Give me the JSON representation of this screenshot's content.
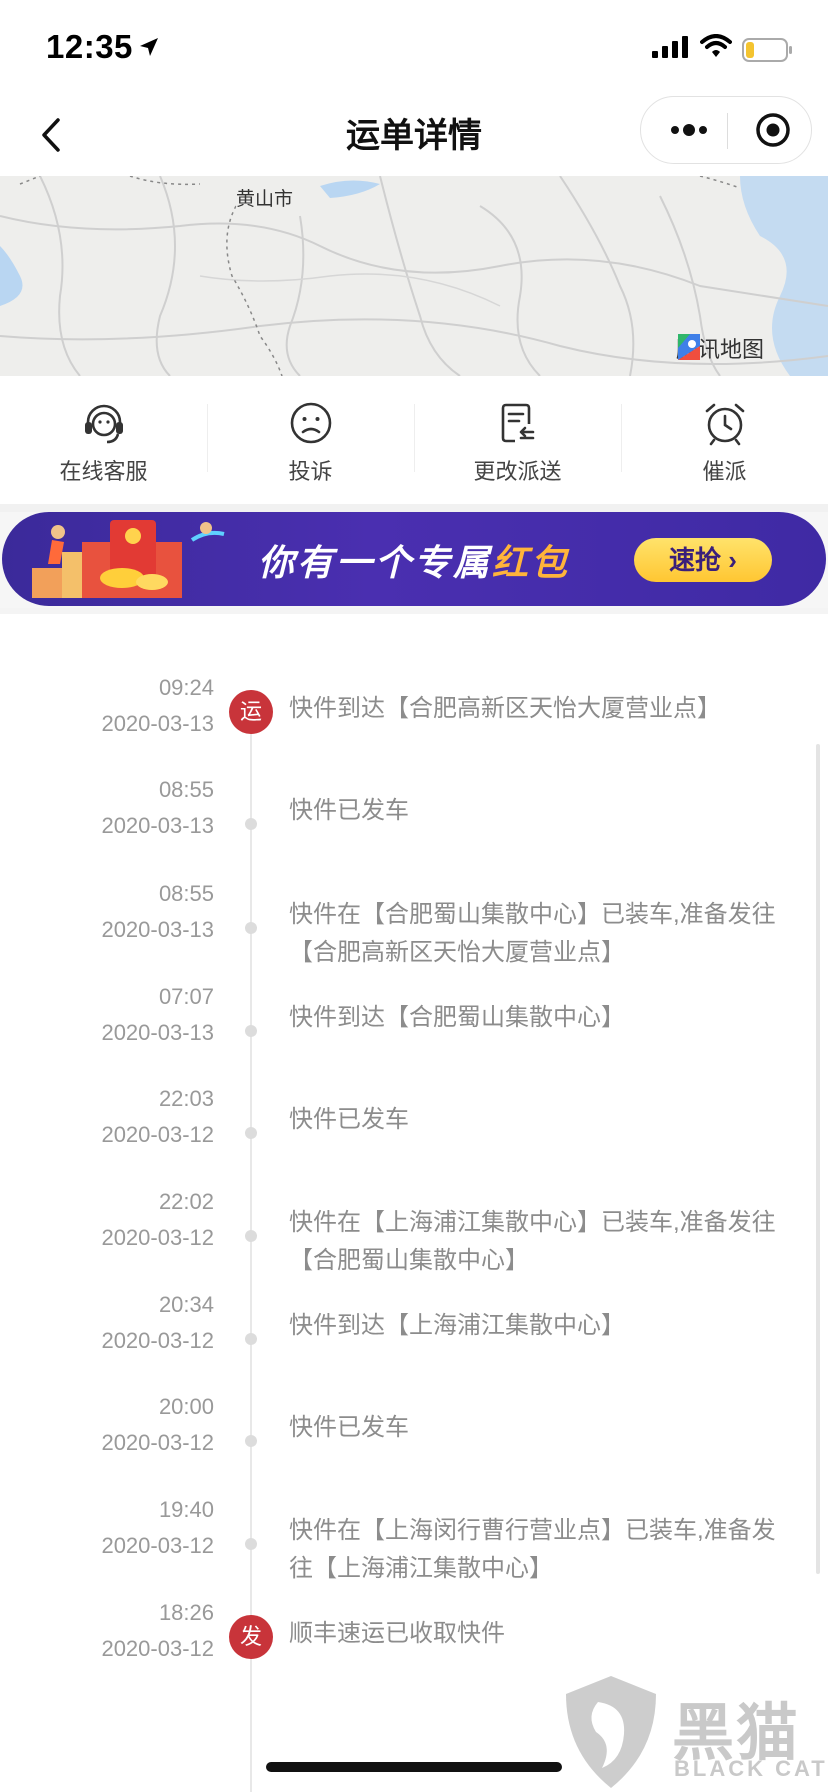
{
  "status_bar": {
    "time": "12:35"
  },
  "nav": {
    "title": "运单详情"
  },
  "map": {
    "city_label": "黄山市",
    "provider": "腾讯地图"
  },
  "actions": [
    {
      "label": "在线客服",
      "icon": "headset-icon"
    },
    {
      "label": "投诉",
      "icon": "sad-face-icon"
    },
    {
      "label": "更改派送",
      "icon": "edit-document-icon"
    },
    {
      "label": "催派",
      "icon": "alarm-clock-icon"
    }
  ],
  "banner": {
    "text_prefix": "你有一个专属",
    "text_highlight": "红包",
    "button_label": "速抢"
  },
  "timeline": [
    {
      "time": "09:24",
      "date": "2020-03-13",
      "text": "快件到达【合肥高新区天怡大厦营业点】",
      "badge": "运"
    },
    {
      "time": "08:55",
      "date": "2020-03-13",
      "text": "快件已发车",
      "badge": ""
    },
    {
      "time": "08:55",
      "date": "2020-03-13",
      "text": "快件在【合肥蜀山集散中心】已装车,准备发往【合肥高新区天怡大厦营业点】",
      "badge": ""
    },
    {
      "time": "07:07",
      "date": "2020-03-13",
      "text": "快件到达【合肥蜀山集散中心】",
      "badge": ""
    },
    {
      "time": "22:03",
      "date": "2020-03-12",
      "text": "快件已发车",
      "badge": ""
    },
    {
      "time": "22:02",
      "date": "2020-03-12",
      "text": "快件在【上海浦江集散中心】已装车,准备发往【合肥蜀山集散中心】",
      "badge": ""
    },
    {
      "time": "20:34",
      "date": "2020-03-12",
      "text": "快件到达【上海浦江集散中心】",
      "badge": ""
    },
    {
      "time": "20:00",
      "date": "2020-03-12",
      "text": "快件已发车",
      "badge": ""
    },
    {
      "time": "19:40",
      "date": "2020-03-12",
      "text": "快件在【上海闵行曹行营业点】已装车,准备发往【上海浦江集散中心】",
      "badge": ""
    },
    {
      "time": "18:26",
      "date": "2020-03-12",
      "text": "顺丰速运已收取快件",
      "badge": "发"
    }
  ],
  "watermark": {
    "text": "黑猫",
    "sub": "BLACK CAT"
  },
  "colors": {
    "badge_red": "#c8343a",
    "banner_purple": "#4a2fb0",
    "banner_button": "#ffc632"
  }
}
